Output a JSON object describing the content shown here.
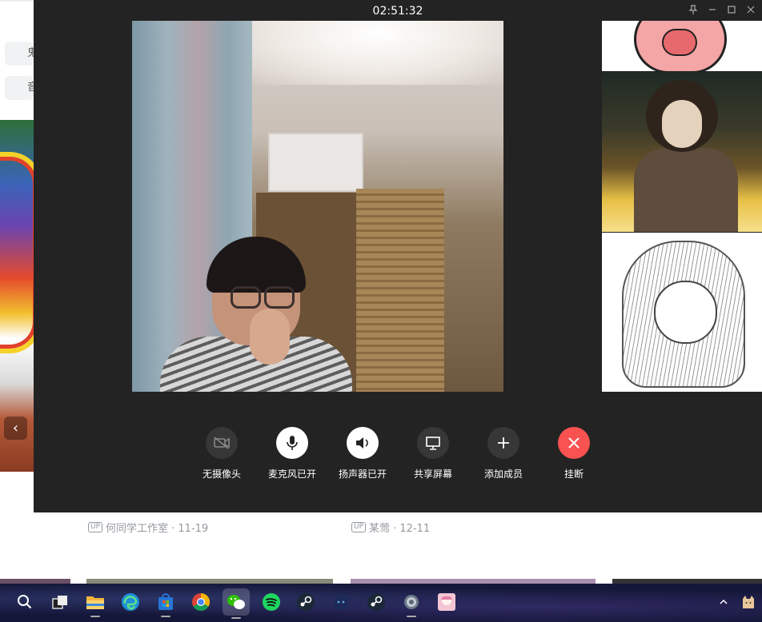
{
  "background_page": {
    "left_buttons": [
      "鬼",
      "音"
    ],
    "prev_arrow": "‹",
    "cards": [
      {
        "up_badge": "UP",
        "author_date": "何同学工作室 · 11-19"
      },
      {
        "up_badge": "UP",
        "author_date": "某莺 · 12-11"
      }
    ]
  },
  "call": {
    "timer": "02:51:32",
    "window_controls": [
      "pin-icon",
      "minimize-icon",
      "maximize-icon",
      "close-icon"
    ],
    "controls": [
      {
        "label": "无摄像头",
        "icon": "camera-off-icon",
        "style": "dark"
      },
      {
        "label": "麦克风已开",
        "icon": "microphone-icon",
        "style": "light"
      },
      {
        "label": "扬声器已开",
        "icon": "speaker-icon",
        "style": "light"
      },
      {
        "label": "共享屏幕",
        "icon": "screen-share-icon",
        "style": "dark"
      },
      {
        "label": "添加成员",
        "icon": "add-member-icon",
        "style": "dark"
      },
      {
        "label": "挂断",
        "icon": "hang-up-icon",
        "style": "red"
      }
    ],
    "colors": {
      "window_bg": "#232323",
      "hangup": "#fa5151",
      "dark_btn": "#373737"
    }
  },
  "taskbar": {
    "icons": [
      "search-icon",
      "task-view-icon",
      "file-explorer-icon",
      "edge-icon",
      "store-icon",
      "chrome-icon",
      "wechat-icon",
      "spotify-icon",
      "steam-icon",
      "app-icon",
      "steam-icon",
      "settings-icon",
      "avatar-app-icon"
    ],
    "active": "wechat-icon"
  }
}
